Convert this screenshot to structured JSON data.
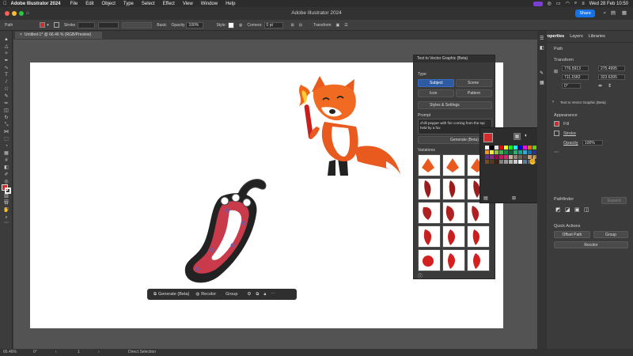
{
  "menubar": {
    "app": "Adobe Illustrator 2024",
    "items": [
      "File",
      "Edit",
      "Object",
      "Type",
      "Select",
      "Effect",
      "View",
      "Window",
      "Help"
    ],
    "clock": "Wed 28 Feb  10:50"
  },
  "window": {
    "title": "Adobe Illustrator 2024",
    "share": "Share"
  },
  "controlbar": {
    "path_label": "Path",
    "stroke_label": "Stroke",
    "brush": "Basic",
    "opacity_label": "Opacity",
    "opacity": "100%",
    "style_label": "Style:",
    "corners_label": "Corners:",
    "corners": "0 pt",
    "transform_label": "Transform"
  },
  "doc_tab": "Untitled-1* @ 66.46 % (RGB/Preview)",
  "t2v": {
    "title": "Text to Vector Graphic (Beta)",
    "type_label": "Type",
    "types": [
      "Subject",
      "Scene",
      "Icon",
      "Pattern"
    ],
    "styles_label": "Styles & Settings",
    "prompt_label": "Prompt",
    "prompt": "chilli pepper with fire coming from the top held by a fox",
    "generate": "Generate (Beta)",
    "variations_label": "Variations"
  },
  "properties": {
    "tabs": [
      "Properties",
      "Layers",
      "Libraries"
    ],
    "path_label": "Path",
    "transform_label": "Transform",
    "x": "776.5913",
    "y": "711.1582",
    "w": "275.4995",
    "h": "323.6395",
    "angle": "0°",
    "t2v_row": "Text to Vector Graphic (Beta)",
    "appearance_label": "Appearance",
    "fill_label": "Fill",
    "stroke_label": "Stroke",
    "opacity_label": "Opacity",
    "opacity": "100%",
    "pathfinder_label": "Pathfinder",
    "expand_label": "Expand",
    "quick_actions_label": "Quick Actions",
    "offset_path": "Offset Path",
    "group": "Group",
    "recolor": "Recolor"
  },
  "context_bar": {
    "generate": "Generate (Beta)",
    "recolor": "Recolor",
    "group": "Group"
  },
  "status": {
    "zoom": "66.46%",
    "angle": "0°",
    "artboard": "1",
    "tool": "Direct Selection"
  },
  "colors": {
    "accent": "#1473e6",
    "selected_fill": "#d12c2c"
  },
  "picker_colors": [
    "#ffffff",
    "#000000",
    "#e6e6e6",
    "#ff0000",
    "#ffff00",
    "#00ff00",
    "#00ffff",
    "#0000ff",
    "#ff00ff",
    "#ff6600",
    "#66cc00",
    "#cc0000",
    "#f7931e",
    "#fcee21",
    "#8cc63f",
    "#39b54a",
    "#009245",
    "#006837",
    "#22b573",
    "#00a99d",
    "#29abe2",
    "#0071bc",
    "#2e3192",
    "#1b1464",
    "#662d91",
    "#93278f",
    "#9e005d",
    "#d4145a",
    "#ed1e79",
    "#c7b299",
    "#998675",
    "#736357",
    "#534741",
    "#c69c6d",
    "#a67c52",
    "#8c6239",
    "#754c24",
    "#603813",
    "#42210b",
    "#808080",
    "#999999",
    "#b3b3b3",
    "#cccccc",
    "#f2f2f2",
    "#5c7c99",
    "#4d6680",
    "#33475c",
    "#1a2633"
  ]
}
